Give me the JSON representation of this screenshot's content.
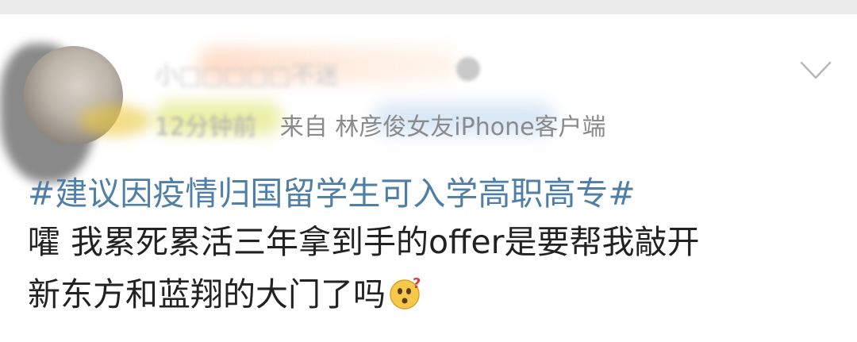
{
  "post": {
    "username": "小□□□□□不迷",
    "meta": {
      "time": "12分钟前",
      "source_prefix": "来自",
      "source": "林彦俊女友iPhone客户端"
    },
    "hashtag": "#建议因疫情归国留学生可入学高职高专#",
    "body_line1": "嚯 我累死累活三年拿到手的offer是要帮我敲开",
    "body_line2": "新东方和蓝翔的大门了吗",
    "emoji": "thinking-face-emoji",
    "icons": {
      "expand": "chevron-down-icon",
      "vip": "vip-badge-icon"
    },
    "colors": {
      "hashtag": "#4f7ea7",
      "text": "#222222",
      "meta": "#8a8a8a"
    }
  }
}
